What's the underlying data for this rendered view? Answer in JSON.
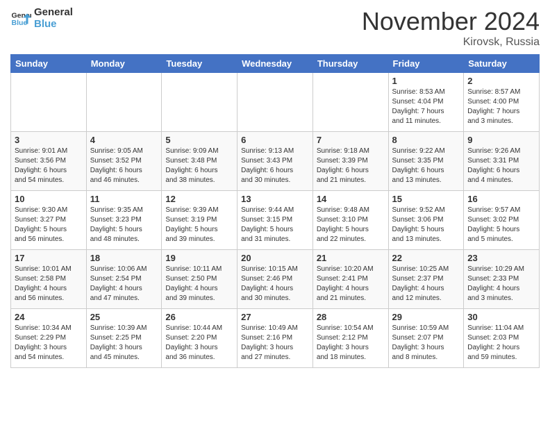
{
  "header": {
    "logo_line1": "General",
    "logo_line2": "Blue",
    "month": "November 2024",
    "location": "Kirovsk, Russia"
  },
  "days_of_week": [
    "Sunday",
    "Monday",
    "Tuesday",
    "Wednesday",
    "Thursday",
    "Friday",
    "Saturday"
  ],
  "weeks": [
    [
      {
        "day": "",
        "info": ""
      },
      {
        "day": "",
        "info": ""
      },
      {
        "day": "",
        "info": ""
      },
      {
        "day": "",
        "info": ""
      },
      {
        "day": "",
        "info": ""
      },
      {
        "day": "1",
        "info": "Sunrise: 8:53 AM\nSunset: 4:04 PM\nDaylight: 7 hours\nand 11 minutes."
      },
      {
        "day": "2",
        "info": "Sunrise: 8:57 AM\nSunset: 4:00 PM\nDaylight: 7 hours\nand 3 minutes."
      }
    ],
    [
      {
        "day": "3",
        "info": "Sunrise: 9:01 AM\nSunset: 3:56 PM\nDaylight: 6 hours\nand 54 minutes."
      },
      {
        "day": "4",
        "info": "Sunrise: 9:05 AM\nSunset: 3:52 PM\nDaylight: 6 hours\nand 46 minutes."
      },
      {
        "day": "5",
        "info": "Sunrise: 9:09 AM\nSunset: 3:48 PM\nDaylight: 6 hours\nand 38 minutes."
      },
      {
        "day": "6",
        "info": "Sunrise: 9:13 AM\nSunset: 3:43 PM\nDaylight: 6 hours\nand 30 minutes."
      },
      {
        "day": "7",
        "info": "Sunrise: 9:18 AM\nSunset: 3:39 PM\nDaylight: 6 hours\nand 21 minutes."
      },
      {
        "day": "8",
        "info": "Sunrise: 9:22 AM\nSunset: 3:35 PM\nDaylight: 6 hours\nand 13 minutes."
      },
      {
        "day": "9",
        "info": "Sunrise: 9:26 AM\nSunset: 3:31 PM\nDaylight: 6 hours\nand 4 minutes."
      }
    ],
    [
      {
        "day": "10",
        "info": "Sunrise: 9:30 AM\nSunset: 3:27 PM\nDaylight: 5 hours\nand 56 minutes."
      },
      {
        "day": "11",
        "info": "Sunrise: 9:35 AM\nSunset: 3:23 PM\nDaylight: 5 hours\nand 48 minutes."
      },
      {
        "day": "12",
        "info": "Sunrise: 9:39 AM\nSunset: 3:19 PM\nDaylight: 5 hours\nand 39 minutes."
      },
      {
        "day": "13",
        "info": "Sunrise: 9:44 AM\nSunset: 3:15 PM\nDaylight: 5 hours\nand 31 minutes."
      },
      {
        "day": "14",
        "info": "Sunrise: 9:48 AM\nSunset: 3:10 PM\nDaylight: 5 hours\nand 22 minutes."
      },
      {
        "day": "15",
        "info": "Sunrise: 9:52 AM\nSunset: 3:06 PM\nDaylight: 5 hours\nand 13 minutes."
      },
      {
        "day": "16",
        "info": "Sunrise: 9:57 AM\nSunset: 3:02 PM\nDaylight: 5 hours\nand 5 minutes."
      }
    ],
    [
      {
        "day": "17",
        "info": "Sunrise: 10:01 AM\nSunset: 2:58 PM\nDaylight: 4 hours\nand 56 minutes."
      },
      {
        "day": "18",
        "info": "Sunrise: 10:06 AM\nSunset: 2:54 PM\nDaylight: 4 hours\nand 47 minutes."
      },
      {
        "day": "19",
        "info": "Sunrise: 10:11 AM\nSunset: 2:50 PM\nDaylight: 4 hours\nand 39 minutes."
      },
      {
        "day": "20",
        "info": "Sunrise: 10:15 AM\nSunset: 2:46 PM\nDaylight: 4 hours\nand 30 minutes."
      },
      {
        "day": "21",
        "info": "Sunrise: 10:20 AM\nSunset: 2:41 PM\nDaylight: 4 hours\nand 21 minutes."
      },
      {
        "day": "22",
        "info": "Sunrise: 10:25 AM\nSunset: 2:37 PM\nDaylight: 4 hours\nand 12 minutes."
      },
      {
        "day": "23",
        "info": "Sunrise: 10:29 AM\nSunset: 2:33 PM\nDaylight: 4 hours\nand 3 minutes."
      }
    ],
    [
      {
        "day": "24",
        "info": "Sunrise: 10:34 AM\nSunset: 2:29 PM\nDaylight: 3 hours\nand 54 minutes."
      },
      {
        "day": "25",
        "info": "Sunrise: 10:39 AM\nSunset: 2:25 PM\nDaylight: 3 hours\nand 45 minutes."
      },
      {
        "day": "26",
        "info": "Sunrise: 10:44 AM\nSunset: 2:20 PM\nDaylight: 3 hours\nand 36 minutes."
      },
      {
        "day": "27",
        "info": "Sunrise: 10:49 AM\nSunset: 2:16 PM\nDaylight: 3 hours\nand 27 minutes."
      },
      {
        "day": "28",
        "info": "Sunrise: 10:54 AM\nSunset: 2:12 PM\nDaylight: 3 hours\nand 18 minutes."
      },
      {
        "day": "29",
        "info": "Sunrise: 10:59 AM\nSunset: 2:07 PM\nDaylight: 3 hours\nand 8 minutes."
      },
      {
        "day": "30",
        "info": "Sunrise: 11:04 AM\nSunset: 2:03 PM\nDaylight: 2 hours\nand 59 minutes."
      }
    ]
  ]
}
